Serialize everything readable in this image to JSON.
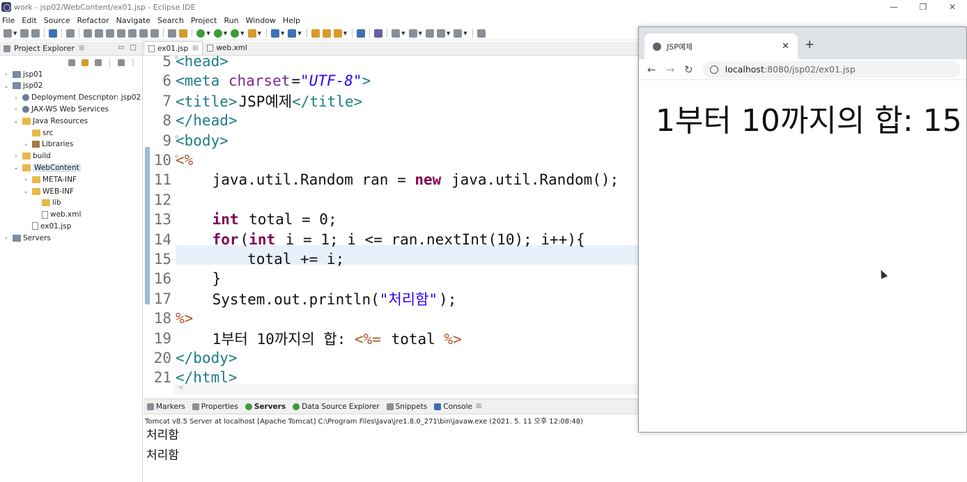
{
  "window": {
    "title": "work - jsp02/WebContent/ex01.jsp - Eclipse IDE",
    "minimize": "—",
    "restore": "❐",
    "close": "✕"
  },
  "menu": [
    "File",
    "Edit",
    "Source",
    "Refactor",
    "Navigate",
    "Search",
    "Project",
    "Run",
    "Window",
    "Help"
  ],
  "explorer": {
    "title": "Project Explorer",
    "close": "☒",
    "tree": [
      {
        "label": "jsp01",
        "arrow": "›",
        "indent": 0,
        "icon": "proj"
      },
      {
        "label": "jsp02",
        "arrow": "⌄",
        "indent": 0,
        "icon": "proj"
      },
      {
        "label": "Deployment Descriptor: jsp02",
        "arrow": "›",
        "indent": 1,
        "icon": "gear"
      },
      {
        "label": "JAX-WS Web Services",
        "arrow": "›",
        "indent": 1,
        "icon": "gear"
      },
      {
        "label": "Java Resources",
        "arrow": "⌄",
        "indent": 1,
        "icon": "folder"
      },
      {
        "label": "src",
        "arrow": "",
        "indent": 2,
        "icon": "folder"
      },
      {
        "label": "Libraries",
        "arrow": "›",
        "indent": 2,
        "icon": "lib"
      },
      {
        "label": "build",
        "arrow": "›",
        "indent": 1,
        "icon": "folder"
      },
      {
        "label": "WebContent",
        "arrow": "⌄",
        "indent": 1,
        "icon": "folder",
        "selected": true
      },
      {
        "label": "META-INF",
        "arrow": "›",
        "indent": 2,
        "icon": "folder"
      },
      {
        "label": "WEB-INF",
        "arrow": "⌄",
        "indent": 2,
        "icon": "folder"
      },
      {
        "label": "lib",
        "arrow": "",
        "indent": 3,
        "icon": "folder"
      },
      {
        "label": "web.xml",
        "arrow": "",
        "indent": 3,
        "icon": "file"
      },
      {
        "label": "ex01.jsp",
        "arrow": "",
        "indent": 2,
        "icon": "file"
      },
      {
        "label": "Servers",
        "arrow": "›",
        "indent": 0,
        "icon": "server"
      }
    ]
  },
  "editor": {
    "tabs": [
      {
        "label": "ex01.jsp",
        "active": true,
        "close": "☒"
      },
      {
        "label": "web.xml",
        "active": false
      }
    ],
    "lines": [
      {
        "n": "5",
        "fold": "⊖",
        "segs": [
          [
            "tag",
            "<head>"
          ]
        ]
      },
      {
        "n": "6",
        "segs": [
          [
            "tag",
            "<meta "
          ],
          [
            "attr",
            "charset"
          ],
          [
            "txt",
            "="
          ],
          [
            "str",
            "\"UTF-8\""
          ],
          [
            "tag",
            ">"
          ]
        ]
      },
      {
        "n": "7",
        "segs": [
          [
            "tag",
            "<title>"
          ],
          [
            "txt",
            "JSP예제"
          ],
          [
            "tag",
            "</title>"
          ]
        ]
      },
      {
        "n": "8",
        "segs": [
          [
            "tag",
            "</head>"
          ]
        ]
      },
      {
        "n": "9",
        "fold": "⊖",
        "segs": [
          [
            "tag",
            "<body>"
          ]
        ]
      },
      {
        "n": "10",
        "fold": "⊖",
        "segs": [
          [
            "jsp",
            "<%"
          ]
        ]
      },
      {
        "n": "11",
        "segs": [
          [
            "txt",
            "    java.util.Random ran = "
          ],
          [
            "kw",
            "new"
          ],
          [
            "txt",
            " java.util.Random();"
          ]
        ]
      },
      {
        "n": "12",
        "segs": [
          [
            "txt",
            ""
          ]
        ]
      },
      {
        "n": "13",
        "segs": [
          [
            "txt",
            "    "
          ],
          [
            "kw",
            "int"
          ],
          [
            "txt",
            " total = 0;"
          ]
        ]
      },
      {
        "n": "14",
        "segs": [
          [
            "txt",
            "    "
          ],
          [
            "kw",
            "for"
          ],
          [
            "txt",
            "("
          ],
          [
            "kw",
            "int"
          ],
          [
            "txt",
            " i = 1; i <= ran.nextInt(10); i++){"
          ]
        ]
      },
      {
        "n": "15",
        "segs": [
          [
            "txt",
            "        total += i;"
          ]
        ]
      },
      {
        "n": "16",
        "segs": [
          [
            "txt",
            "    }"
          ]
        ]
      },
      {
        "n": "17",
        "segs": [
          [
            "txt",
            "    System.out.println("
          ],
          [
            "jstr",
            "\"처리함\""
          ],
          [
            "txt",
            ");"
          ]
        ]
      },
      {
        "n": "18",
        "segs": [
          [
            "jsp",
            "%>"
          ]
        ]
      },
      {
        "n": "19",
        "segs": [
          [
            "txt",
            "    1부터 10까지의 합: "
          ],
          [
            "jsp",
            "<%="
          ],
          [
            "txt",
            " total "
          ],
          [
            "jsp",
            "%>"
          ]
        ]
      },
      {
        "n": "20",
        "segs": [
          [
            "tag",
            "</body>"
          ]
        ]
      },
      {
        "n": "21",
        "segs": [
          [
            "tag",
            "</html>"
          ]
        ]
      }
    ],
    "scroll_marker": "<"
  },
  "console": {
    "tabs": [
      {
        "label": "Markers",
        "bold": false
      },
      {
        "label": "Properties",
        "bold": false
      },
      {
        "label": "Servers",
        "bold": true
      },
      {
        "label": "Data Source Explorer",
        "bold": false
      },
      {
        "label": "Snippets",
        "bold": false
      },
      {
        "label": "Console",
        "bold": false,
        "close": "☒"
      }
    ],
    "description": "Tomcat v8.5 Server at localhost [Apache Tomcat] C:\\Program Files\\Java\\jre1.8.0_271\\bin\\javaw.exe  (2021. 5. 11 오후 12:08:48)",
    "output": [
      "처리함",
      "처리함"
    ]
  },
  "browser": {
    "tab_title": "JSP예제",
    "tab_close": "✕",
    "new_tab": "+",
    "back": "←",
    "forward": "→",
    "reload": "↻",
    "address_host": "localhost",
    "address_path": ":8080/jsp02/ex01.jsp",
    "page_text": "1부터 10까지의 합: 15"
  }
}
